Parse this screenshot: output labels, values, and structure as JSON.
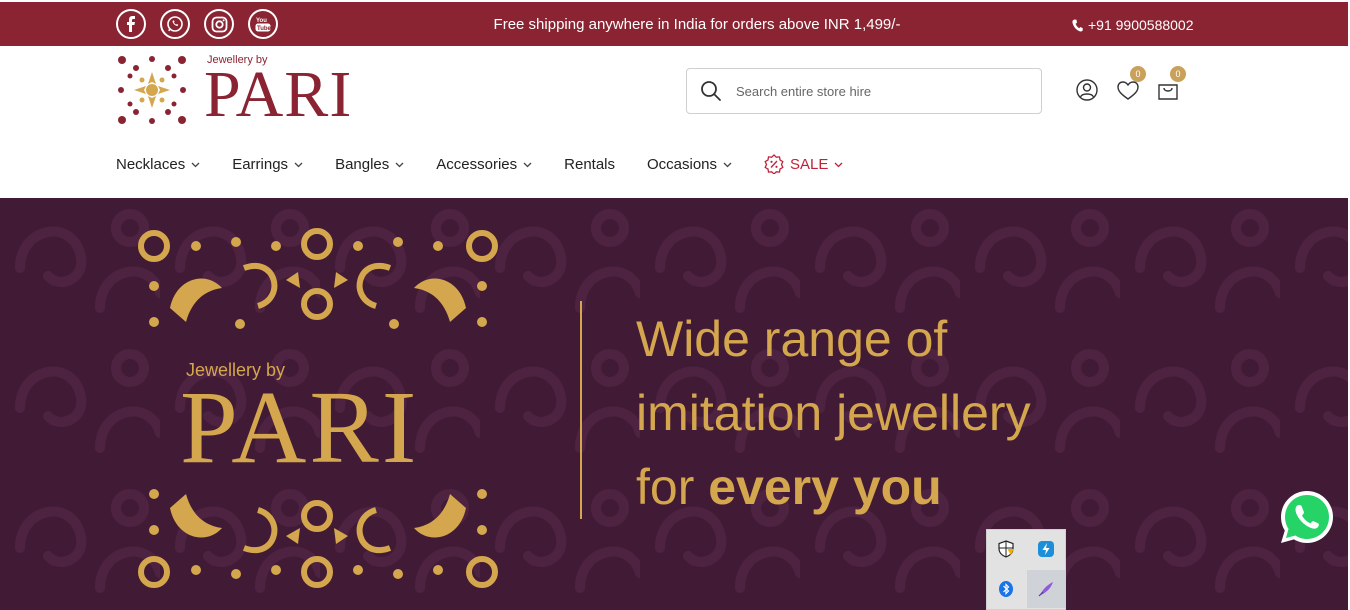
{
  "topbar": {
    "shipping_text": "Free shipping anywhere in India for orders above INR 1,499/-",
    "phone": "+91 9900588002",
    "social_icons": [
      "facebook-icon",
      "whatsapp-icon",
      "instagram-icon",
      "youtube-icon"
    ]
  },
  "header": {
    "logo_by": "Jewellery by",
    "logo_name": "PARI",
    "search_placeholder": "Search entire store hire",
    "wishlist_count": "0",
    "cart_count": "0"
  },
  "nav": {
    "items": [
      {
        "label": "Necklaces",
        "dropdown": true
      },
      {
        "label": "Earrings",
        "dropdown": true
      },
      {
        "label": "Bangles",
        "dropdown": true
      },
      {
        "label": "Accessories",
        "dropdown": true
      },
      {
        "label": "Rentals",
        "dropdown": false
      },
      {
        "label": "Occasions",
        "dropdown": true
      },
      {
        "label": "SALE",
        "dropdown": true
      }
    ]
  },
  "banner": {
    "by": "Jewellery by",
    "name": "PARI",
    "line1": "Wide range of",
    "line2": "imitation jewellery",
    "line3_prefix": "for ",
    "line3_bold": "every you"
  },
  "colors": {
    "brand": "#8a2432",
    "banner_bg": "#411b35",
    "gold": "#d4a64d",
    "sale": "#c0213a",
    "badge": "#c9a15b"
  }
}
